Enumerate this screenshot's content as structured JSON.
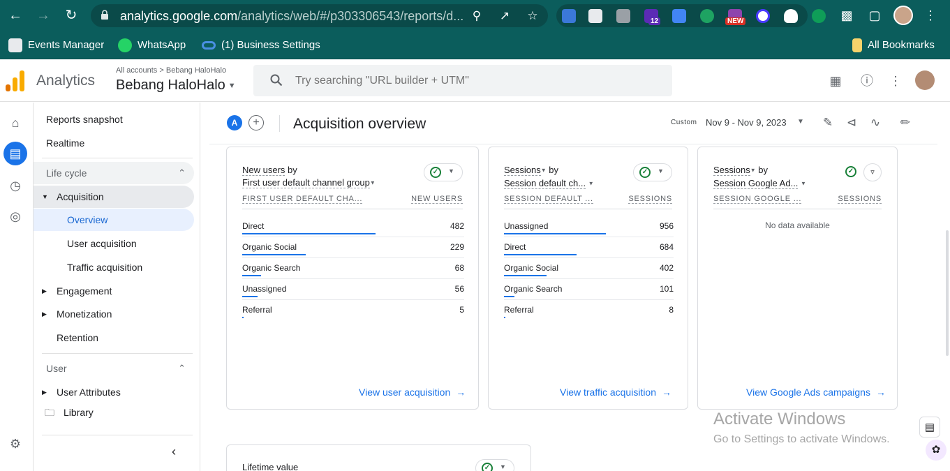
{
  "browser": {
    "url_host": "analytics.google.com",
    "url_path": "/analytics/web/#/p303306543/reports/d...",
    "ext_badge_12": "12",
    "ext_badge_new": "NEW",
    "bookmarks": [
      {
        "label": "Events Manager"
      },
      {
        "label": "WhatsApp"
      },
      {
        "label": "(1) Business Settings"
      }
    ],
    "all_bookmarks": "All Bookmarks"
  },
  "ga": {
    "product": "Analytics",
    "crumb_all": "All accounts",
    "crumb_sep": ">",
    "crumb_account": "Bebang HaloHalo",
    "property": "Bebang HaloHalo",
    "search_placeholder": "Try searching \"URL builder + UTM\""
  },
  "sidenav": {
    "reports_snapshot": "Reports snapshot",
    "realtime": "Realtime",
    "life_cycle": "Life cycle",
    "acquisition": "Acquisition",
    "overview": "Overview",
    "user_acquisition": "User acquisition",
    "traffic_acquisition": "Traffic acquisition",
    "engagement": "Engagement",
    "monetization": "Monetization",
    "retention": "Retention",
    "user": "User",
    "user_attributes": "User Attributes",
    "library": "Library"
  },
  "toolbar": {
    "segment": "A",
    "title": "Acquisition overview",
    "date_custom": "Custom",
    "date_range": "Nov 9 - Nov 9, 2023"
  },
  "cards": [
    {
      "metric": "New users",
      "by": "by",
      "dimension": "First user default channel group",
      "col_dim": "FIRST USER DEFAULT CHA...",
      "col_metric": "NEW USERS",
      "rows": [
        {
          "label": "Direct",
          "value": "482",
          "frac": 1.0
        },
        {
          "label": "Organic Social",
          "value": "229",
          "frac": 0.475
        },
        {
          "label": "Organic Search",
          "value": "68",
          "frac": 0.141
        },
        {
          "label": "Unassigned",
          "value": "56",
          "frac": 0.116
        },
        {
          "label": "Referral",
          "value": "5",
          "frac": 0.01
        }
      ],
      "link": "View user acquisition"
    },
    {
      "metric": "Sessions",
      "by": "by",
      "dimension": "Session default ch...",
      "col_dim": "SESSION DEFAULT ...",
      "col_metric": "SESSIONS",
      "rows": [
        {
          "label": "Unassigned",
          "value": "956",
          "frac": 1.0
        },
        {
          "label": "Direct",
          "value": "684",
          "frac": 0.715
        },
        {
          "label": "Organic Social",
          "value": "402",
          "frac": 0.42
        },
        {
          "label": "Organic Search",
          "value": "101",
          "frac": 0.106
        },
        {
          "label": "Referral",
          "value": "8",
          "frac": 0.008
        }
      ],
      "link": "View traffic acquisition"
    },
    {
      "metric": "Sessions",
      "by": "by",
      "dimension": "Session Google Ad...",
      "col_dim": "SESSION GOOGLE ...",
      "col_metric": "SESSIONS",
      "no_data": "No data available",
      "link": "View Google Ads campaigns"
    }
  ],
  "lifetime_card": {
    "title": "Lifetime value"
  },
  "watermark": {
    "line1": "Activate Windows",
    "line2": "Go to Settings to activate Windows."
  }
}
